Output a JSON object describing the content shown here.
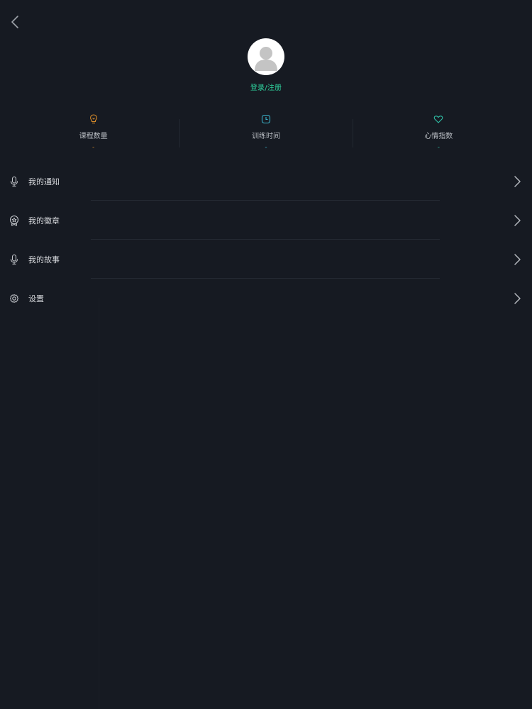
{
  "header": {
    "back_icon": "chevron-left-icon"
  },
  "profile": {
    "avatar_icon": "default-user-icon",
    "login_label": "登录/注册"
  },
  "stats": [
    {
      "label": "课程数量",
      "value": "-",
      "icon": "lightbulb-icon",
      "color": "#d4892a"
    },
    {
      "label": "训练时间",
      "value": "-",
      "icon": "clock-icon",
      "color": "#3ab0c8"
    },
    {
      "label": "心情指数",
      "value": "-",
      "icon": "heart-icon",
      "color": "#2fbfa6"
    }
  ],
  "menu": [
    {
      "label": "我的通知",
      "icon": "microphone-icon"
    },
    {
      "label": "我的徽章",
      "icon": "badge-icon"
    },
    {
      "label": "我的故事",
      "icon": "microphone-icon"
    },
    {
      "label": "设置",
      "icon": "gear-icon"
    }
  ],
  "colors": {
    "background": "#161a22",
    "accent_green": "#2fd6a0"
  }
}
